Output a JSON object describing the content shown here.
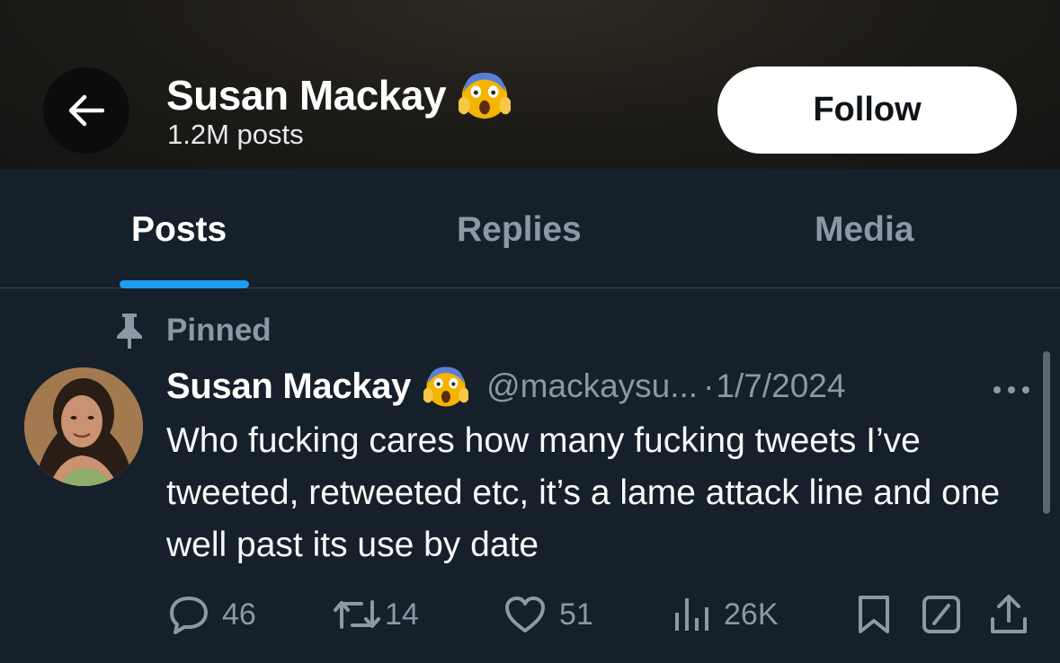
{
  "header": {
    "name": "Susan Mackay",
    "name_emoji": "face-screaming-in-fear",
    "post_count": "1.2M posts",
    "follow_label": "Follow",
    "back_icon": "arrow-left-icon"
  },
  "tabs": [
    {
      "label": "Posts",
      "active": true
    },
    {
      "label": "Replies",
      "active": false
    },
    {
      "label": "Media",
      "active": false
    }
  ],
  "pinned": {
    "label": "Pinned",
    "icon": "pin-icon"
  },
  "tweet": {
    "author": "Susan Mackay",
    "handle": "@mackaysu...",
    "separator": "·",
    "date": "1/7/2024",
    "text": "Who fucking cares how many fucking tweets I’ve tweeted, retweeted etc, it’s a lame attack line and one well past its use by date",
    "actions": {
      "replies": "46",
      "reposts": "14",
      "likes": "51",
      "views": "26K"
    }
  },
  "colors": {
    "background": "#15202b",
    "accent": "#1d9bf0",
    "muted": "#8b98a5",
    "text": "#f7f9f9"
  }
}
